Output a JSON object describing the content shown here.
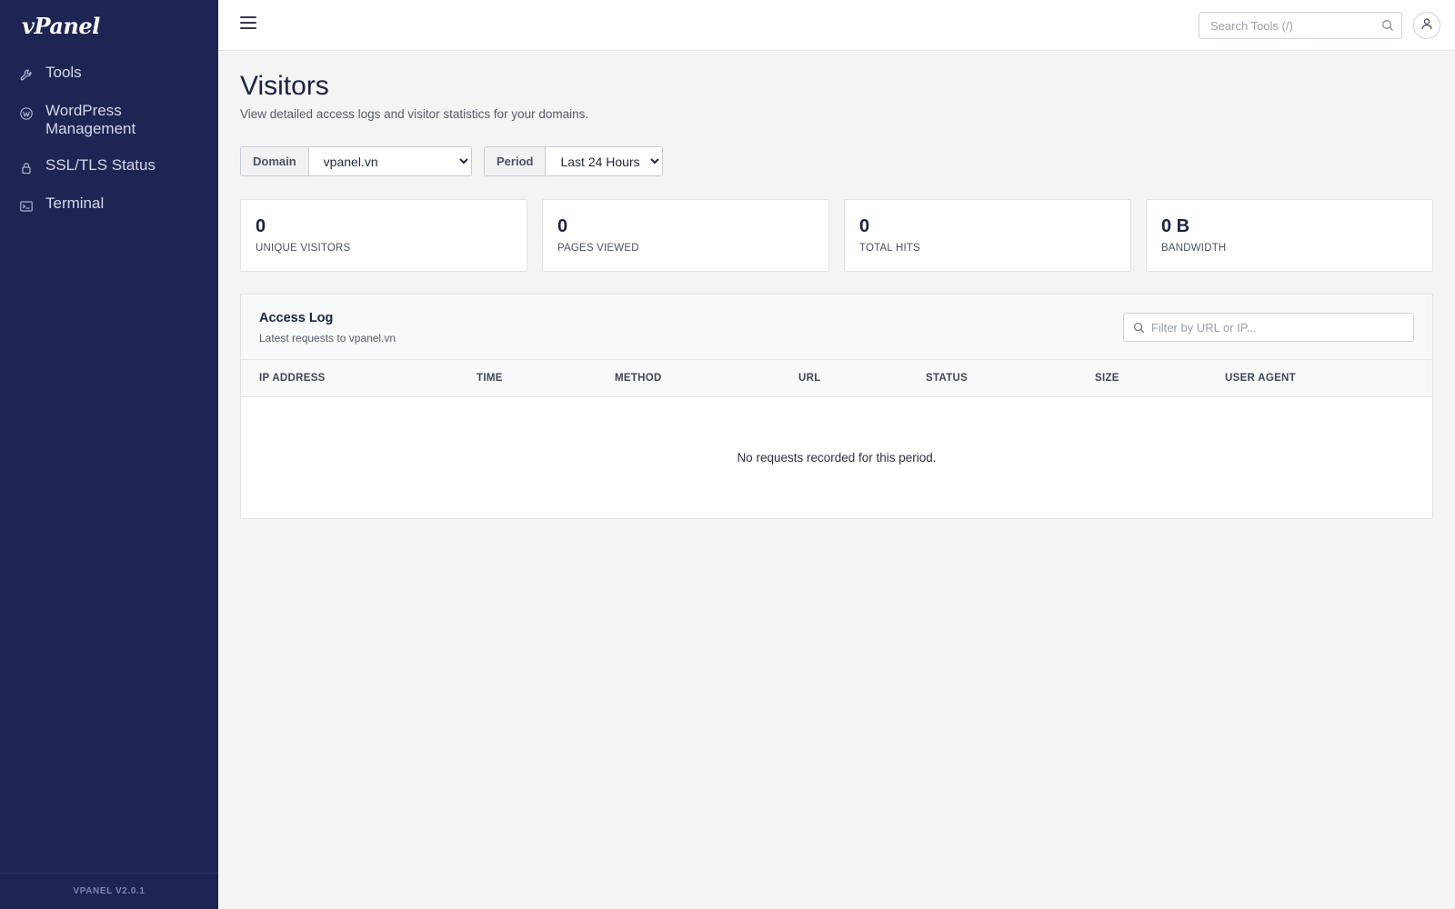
{
  "sidebar": {
    "logo": "vPanel",
    "items": [
      {
        "label": "Tools",
        "icon": "wrench-icon"
      },
      {
        "label": "WordPress Management",
        "icon": "wordpress-icon"
      },
      {
        "label": "SSL/TLS Status",
        "icon": "lock-icon"
      },
      {
        "label": "Terminal",
        "icon": "terminal-icon"
      }
    ],
    "version": "VPANEL V2.0.1"
  },
  "topbar": {
    "search_placeholder": "Search Tools (/)"
  },
  "page": {
    "title": "Visitors",
    "subtitle": "View detailed access logs and visitor statistics for your domains."
  },
  "filters": {
    "domain_label": "Domain",
    "domain_value": "vpanel.vn",
    "period_label": "Period",
    "period_value": "Last 24 Hours"
  },
  "stats": [
    {
      "value": "0",
      "label": "UNIQUE VISITORS"
    },
    {
      "value": "0",
      "label": "PAGES VIEWED"
    },
    {
      "value": "0",
      "label": "TOTAL HITS"
    },
    {
      "value": "0 B",
      "label": "BANDWIDTH"
    }
  ],
  "access_log": {
    "title": "Access Log",
    "subtitle": "Latest requests to vpanel.vn",
    "filter_placeholder": "Filter by URL or IP...",
    "columns": [
      "IP ADDRESS",
      "TIME",
      "METHOD",
      "URL",
      "STATUS",
      "SIZE",
      "USER AGENT"
    ],
    "empty_message": "No requests recorded for this period."
  },
  "colors": {
    "sidebar_bg": "#1f2553",
    "page_bg": "#f4f4f4",
    "heading": "#1c2340"
  }
}
